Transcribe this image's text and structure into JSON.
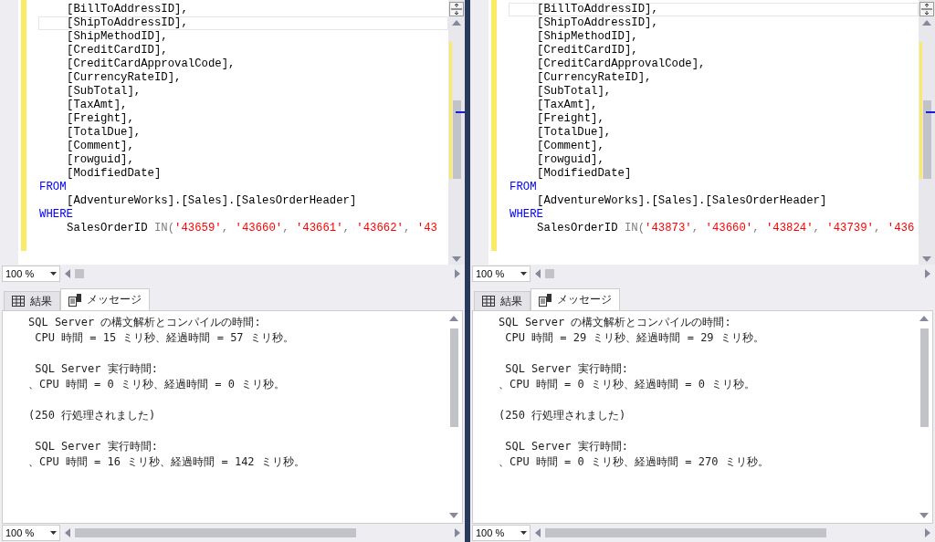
{
  "panes": [
    {
      "code": {
        "columns": [
          {
            "text": "[BillToAddressID],",
            "selected": false
          },
          {
            "text": "[ShipToAddressID],",
            "selected": true
          },
          {
            "text": "[ShipMethodID],",
            "selected": false
          },
          {
            "text": "[CreditCardID],",
            "selected": false
          },
          {
            "text": "[CreditCardApprovalCode],",
            "selected": false
          },
          {
            "text": "[CurrencyRateID],",
            "selected": false
          },
          {
            "text": "[SubTotal],",
            "selected": false
          },
          {
            "text": "[TaxAmt],",
            "selected": false
          },
          {
            "text": "[Freight],",
            "selected": false
          },
          {
            "text": "[TotalDue],",
            "selected": false
          },
          {
            "text": "[Comment],",
            "selected": false
          },
          {
            "text": "[rowguid],",
            "selected": false
          },
          {
            "text": "[ModifiedDate]",
            "selected": false
          }
        ],
        "from_keyword": "FROM",
        "table": "[AdventureWorks].[Sales].[SalesOrderHeader]",
        "where_keyword": "WHERE",
        "condition": {
          "column": "SalesOrderID",
          "operator": "IN(",
          "separator": ",",
          "values": [
            "'43659'",
            "'43660'",
            "'43661'",
            "'43662'",
            "'43"
          ]
        }
      },
      "editor_zoom": "100 %",
      "tabs": [
        {
          "label": "結果",
          "kind": "grid",
          "selected": false
        },
        {
          "label": "メッセージ",
          "kind": "messages",
          "selected": true
        }
      ],
      "messages": [
        [
          "SQL Server の構文解析とコンパイルの時間:",
          " CPU 時間 = 15 ミリ秒、経過時間 = 57 ミリ秒。"
        ],
        [
          " SQL Server 実行時間:",
          "、CPU 時間 = 0 ミリ秒、経過時間 = 0 ミリ秒。"
        ],
        [
          "(250 行処理されました)"
        ],
        [
          " SQL Server 実行時間:",
          "、CPU 時間 = 16 ミリ秒、経過時間 = 142 ミリ秒。"
        ]
      ],
      "messages_zoom": "100 %"
    },
    {
      "code": {
        "columns": [
          {
            "text": "[BillToAddressID],",
            "selected": true
          },
          {
            "text": "[ShipToAddressID],",
            "selected": false
          },
          {
            "text": "[ShipMethodID],",
            "selected": false
          },
          {
            "text": "[CreditCardID],",
            "selected": false
          },
          {
            "text": "[CreditCardApprovalCode],",
            "selected": false
          },
          {
            "text": "[CurrencyRateID],",
            "selected": false
          },
          {
            "text": "[SubTotal],",
            "selected": false
          },
          {
            "text": "[TaxAmt],",
            "selected": false
          },
          {
            "text": "[Freight],",
            "selected": false
          },
          {
            "text": "[TotalDue],",
            "selected": false
          },
          {
            "text": "[Comment],",
            "selected": false
          },
          {
            "text": "[rowguid],",
            "selected": false
          },
          {
            "text": "[ModifiedDate]",
            "selected": false
          }
        ],
        "from_keyword": "FROM",
        "table": "[AdventureWorks].[Sales].[SalesOrderHeader]",
        "where_keyword": "WHERE",
        "condition": {
          "column": "SalesOrderID",
          "operator": "IN(",
          "separator": ",",
          "values": [
            "'43873'",
            "'43660'",
            "'43824'",
            "'43739'",
            "'436"
          ]
        }
      },
      "editor_zoom": "100 %",
      "tabs": [
        {
          "label": "結果",
          "kind": "grid",
          "selected": false
        },
        {
          "label": "メッセージ",
          "kind": "messages",
          "selected": true
        }
      ],
      "messages": [
        [
          "SQL Server の構文解析とコンパイルの時間:",
          " CPU 時間 = 29 ミリ秒、経過時間 = 29 ミリ秒。"
        ],
        [
          " SQL Server 実行時間:",
          "、CPU 時間 = 0 ミリ秒、経過時間 = 0 ミリ秒。"
        ],
        [
          "(250 行処理されました)"
        ],
        [
          " SQL Server 実行時間:",
          "、CPU 時間 = 0 ミリ秒、経過時間 = 270 ミリ秒。"
        ]
      ],
      "messages_zoom": "100 %"
    }
  ]
}
